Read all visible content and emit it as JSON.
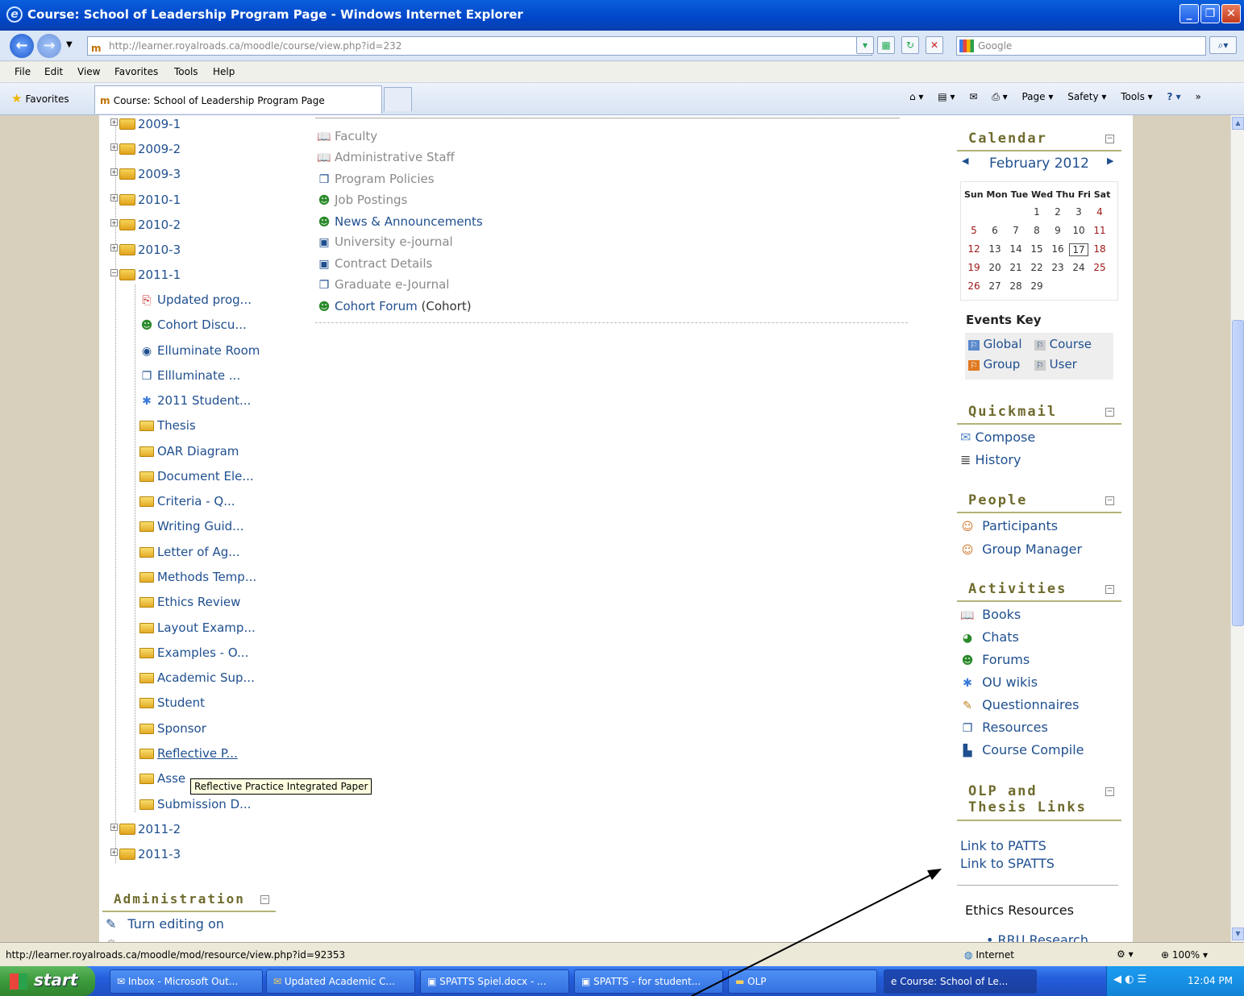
{
  "window": {
    "title": "Course: School of Leadership Program Page - Windows Internet Explorer"
  },
  "address": {
    "url": "http://learner.royalroads.ca/moodle/course/view.php?id=232",
    "search_placeholder": "Google"
  },
  "menu": [
    "File",
    "Edit",
    "View",
    "Favorites",
    "Tools",
    "Help"
  ],
  "favorites": {
    "label": "Favorites",
    "tab_title": "Course: School of Leadership Program Page",
    "commands": [
      "Page ▾",
      "Safety ▾",
      "Tools ▾"
    ]
  },
  "tree": {
    "top_folders": [
      "2009-1",
      "2009-2",
      "2009-3",
      "2010-1",
      "2010-2",
      "2010-3",
      "2011-1"
    ],
    "children": [
      "Updated prog...",
      "Cohort Discu...",
      "Elluminate Room",
      "Ellluminate ...",
      "2011 Student...",
      "Thesis",
      "OAR Diagram",
      "Document Ele...",
      "Criteria - Q...",
      "Writing Guid...",
      "Letter of Ag...",
      "Methods Temp...",
      "Ethics Review",
      "Layout Examp...",
      "Examples - O...",
      "Academic Sup...",
      "Student",
      "Sponsor",
      "Reflective P...",
      "Asse",
      "Submission D..."
    ],
    "bottom_folders": [
      "2011-2",
      "2011-3"
    ]
  },
  "administration": {
    "title": "Administration",
    "turn_editing": "Turn editing on"
  },
  "center": {
    "items": [
      {
        "label": "Faculty",
        "style": "grey",
        "icon": "book-icon"
      },
      {
        "label": "Administrative Staff",
        "style": "grey",
        "icon": "book-icon"
      },
      {
        "label": "Program Policies",
        "style": "grey",
        "icon": "window-icon"
      },
      {
        "label": "Job Postings",
        "style": "grey",
        "icon": "people-icon"
      },
      {
        "label": "News & Announcements",
        "style": "blue",
        "icon": "people-icon"
      },
      {
        "label": "University e-journal",
        "style": "grey",
        "icon": "doc-icon"
      },
      {
        "label": "Contract Details",
        "style": "grey",
        "icon": "doc-icon"
      },
      {
        "label": "Graduate e-Journal",
        "style": "grey",
        "icon": "window-icon"
      },
      {
        "label": "Cohort Forum",
        "style": "blue",
        "icon": "people-icon",
        "suffix": " (Cohort)"
      }
    ]
  },
  "calendar": {
    "title": "Calendar",
    "month": "February 2012",
    "days": [
      "Sun",
      "Mon",
      "Tue",
      "Wed",
      "Thu",
      "Fri",
      "Sat"
    ],
    "weeks": [
      [
        "",
        "",
        "",
        "1",
        "2",
        "3",
        "4"
      ],
      [
        "5",
        "6",
        "7",
        "8",
        "9",
        "10",
        "11"
      ],
      [
        "12",
        "13",
        "14",
        "15",
        "16",
        "17",
        "18"
      ],
      [
        "19",
        "20",
        "21",
        "22",
        "23",
        "24",
        "25"
      ],
      [
        "26",
        "27",
        "28",
        "29",
        "",
        "",
        ""
      ]
    ],
    "today": "17"
  },
  "events_key": {
    "title": "Events Key",
    "items": [
      "Global",
      "Course",
      "Group",
      "User"
    ]
  },
  "quickmail": {
    "title": "Quickmail",
    "items": [
      "Compose",
      "History"
    ]
  },
  "people": {
    "title": "People",
    "items": [
      "Participants",
      "Group Manager"
    ]
  },
  "activities": {
    "title": "Activities",
    "items": [
      "Books",
      "Chats",
      "Forums",
      "OU wikis",
      "Questionnaires",
      "Resources",
      "Course Compile"
    ]
  },
  "olp": {
    "title_line1": "OLP and",
    "title_line2": "Thesis Links",
    "links": [
      "Link to PATTS",
      "Link to SPATTS"
    ],
    "ethics": "Ethics Resources",
    "partial": "RRU Research"
  },
  "tooltip": "Reflective Practice Integrated Paper",
  "status": {
    "url": "http://learner.royalroads.ca/moodle/mod/resource/view.php?id=92353",
    "zone": "Internet",
    "zoom": "100%"
  },
  "taskbar": {
    "start": "start",
    "buttons": [
      "Inbox - Microsoft Out...",
      "Updated Academic C...",
      "SPATTS Spiel.docx - ...",
      "SPATTS - for student...",
      "OLP",
      "Course: School of Le..."
    ],
    "time": "12:04 PM"
  }
}
